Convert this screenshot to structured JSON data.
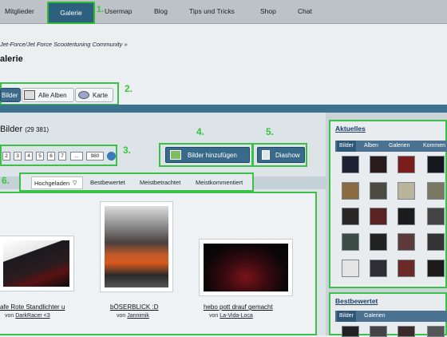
{
  "nav": {
    "items": [
      "Mitglieder",
      "Galerie",
      "Usermap",
      "Blog",
      "Tips und Tricks",
      "Shop",
      "Chat"
    ],
    "active": "Galerie"
  },
  "annotations": [
    "1.",
    "2.",
    "3.",
    "4.",
    "5.",
    "6."
  ],
  "breadcrumb": {
    "link": "Jet-Force/Jet Force Scootertuning Community",
    "sep": "»"
  },
  "gallery_title": "alerie",
  "view_tabs": [
    "Bilder",
    "Alle Alben",
    "Karte"
  ],
  "section": {
    "title": "Bilder",
    "count": "(29 381)"
  },
  "pager": {
    "pages": [
      "2",
      "3",
      "4",
      "5",
      "6",
      "7",
      "...",
      "980"
    ]
  },
  "buttons": {
    "add": "Bilder hinzufügen",
    "slideshow": "Diashow"
  },
  "sort": {
    "options": [
      "Hochgeladen",
      "Bestbewertet",
      "Meistbetrachtet",
      "Meistkommentiert"
    ]
  },
  "items": [
    {
      "caption": "afe Rote Standlichter u",
      "by": "von",
      "user": "DarkRacer <3"
    },
    {
      "caption": "bÖSERBLICK :D",
      "by": "von",
      "user": "Jannimik"
    },
    {
      "caption": "hebo pott drauf gemacht",
      "by": "von",
      "user": "La-Vida-Loca"
    }
  ],
  "sidebar": {
    "current": {
      "title": "Aktuelles",
      "tabs": [
        "Bilder",
        "Alben",
        "Galerien",
        "Kommen"
      ]
    },
    "best": {
      "title": "Bestbewertet",
      "tabs": [
        "Bilder",
        "Galerien"
      ]
    }
  },
  "colors": {
    "annotation": "#39c43e",
    "nav_active": "#2d5f7e",
    "button": "#396a8a",
    "header_bar": "#3d7290"
  }
}
